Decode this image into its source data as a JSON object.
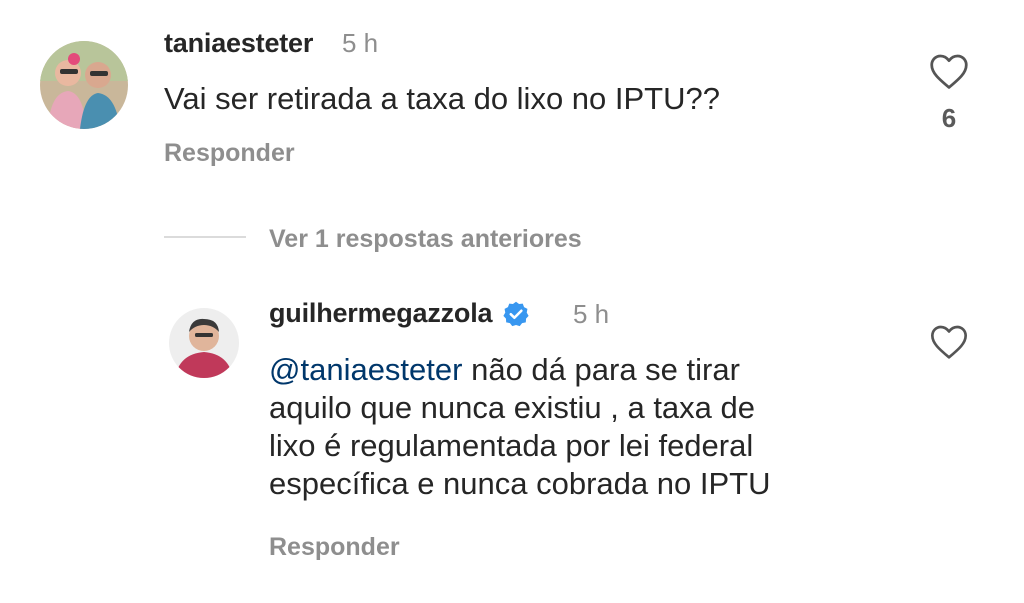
{
  "comment": {
    "username": "taniaesteter",
    "time": "5 h",
    "text": "Vai ser retirada a taxa do lixo no IPTU??",
    "reply_label": "Responder",
    "like_count": "6"
  },
  "view_replies_label": "Ver 1 respostas anteriores",
  "reply": {
    "username": "guilhermegazzola",
    "time": "5 h",
    "mention": "@taniaesteter",
    "text_lines": [
      " não dá para se tirar",
      "aquilo que nunca existiu , a taxa de",
      "lixo é regulamentada por lei federal",
      "específica e nunca cobrada no IPTU"
    ],
    "reply_label": "Responder"
  },
  "colors": {
    "mention": "#00376b",
    "verified": "#3897f0",
    "secondary_text": "#8e8e8e"
  },
  "icons": [
    "heart-icon",
    "verified-badge-icon"
  ]
}
